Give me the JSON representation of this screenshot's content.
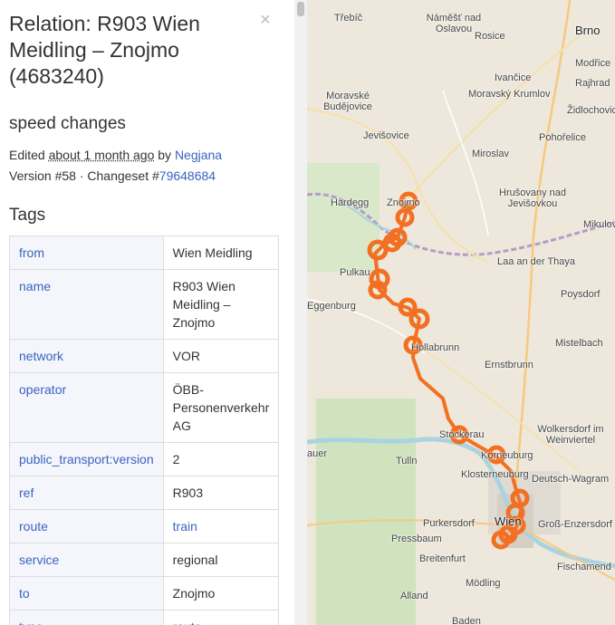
{
  "relation": {
    "title": "Relation: R903 Wien Meidling – Znojmo (4683240)",
    "close": "×",
    "comment": "speed changes",
    "edited_prefix": "Edited ",
    "edited_time": "about 1 month ago",
    "edited_by": " by ",
    "editor": "Negjana",
    "version_text": "Version #58 · Changeset #",
    "changeset": "79648684"
  },
  "tags_heading": "Tags",
  "tags": [
    {
      "key": "from",
      "value": "Wien Meidling",
      "link": false
    },
    {
      "key": "name",
      "value": "R903 Wien Meidling – Znojmo",
      "link": false
    },
    {
      "key": "network",
      "value": "VOR",
      "link": false
    },
    {
      "key": "operator",
      "value": "ÖBB-Personenverkehr AG",
      "link": false
    },
    {
      "key": "public_transport:version",
      "value": "2",
      "link": false
    },
    {
      "key": "ref",
      "value": "R903",
      "link": false
    },
    {
      "key": "route",
      "value": "train",
      "link": true
    },
    {
      "key": "service",
      "value": "regional",
      "link": false
    },
    {
      "key": "to",
      "value": "Znojmo",
      "link": false
    },
    {
      "key": "type",
      "value": "route",
      "link": true
    }
  ],
  "map": {
    "route_color": "#f36f21",
    "places": [
      "Třebíč",
      "Náměšť nad Oslavou",
      "Rosice",
      "Brno",
      "Ivančice",
      "Modřice",
      "Rajhrad",
      "Moravské Budějovice",
      "Moravský Krumlov",
      "Židlochovice",
      "Jevišovice",
      "Miroslav",
      "Pohořelice",
      "Hardegg",
      "Znojmo",
      "Hrušovany nad Jevišovkou",
      "Mikulov",
      "Pulkau",
      "Laa an der Thaya",
      "Poysdorf",
      "Eggenburg",
      "Hollabrunn",
      "Mistelbach",
      "Ernstbrunn",
      "Wolkersdorf im Weinviertel",
      "Stockerau",
      "Korneuburg",
      "Tulln",
      "Klosterneuburg",
      "Deutsch-Wagram",
      "Purkersdorf",
      "Wien",
      "Groß-Enzersdorf",
      "Pressbaum",
      "Breitenfurt",
      "Fischamend",
      "Mödling",
      "Alland",
      "Baden",
      "auer"
    ]
  }
}
